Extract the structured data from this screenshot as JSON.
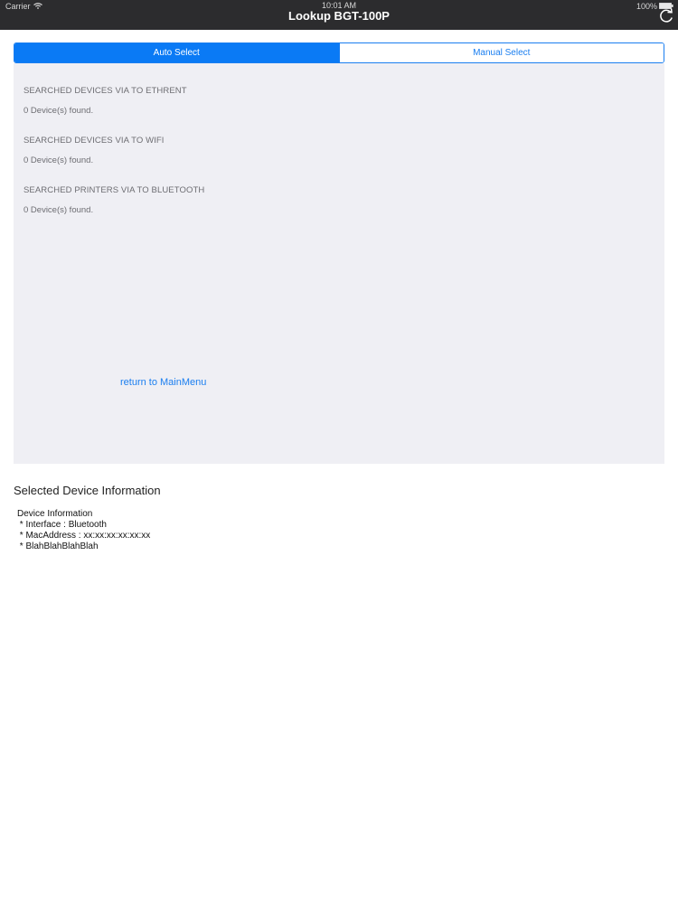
{
  "status_bar": {
    "carrier": "Carrier",
    "time": "10:01 AM",
    "battery": "100%"
  },
  "nav": {
    "title": "Lookup BGT-100P"
  },
  "segments": {
    "auto": "Auto Select",
    "manual": "Manual Select",
    "selected": "Auto Select"
  },
  "sections": [
    {
      "title": "SEARCHED DEVICES VIA TO ETHRENT",
      "count": "0 Device(s) found."
    },
    {
      "title": "SEARCHED DEVICES VIA TO WIFI",
      "count": "0 Device(s) found."
    },
    {
      "title": "SEARCHED PRINTERS VIA TO BLUETOOTH",
      "count": "0 Device(s) found."
    }
  ],
  "return_link": "return to MainMenu",
  "selected_info": {
    "heading": "Selected Device Information",
    "lines": [
      "Device Information",
      " * Interface : Bluetooth",
      " * MacAddress : xx:xx:xx:xx:xx:xx",
      " * BlahBlahBlahBlah"
    ]
  },
  "icons": {
    "wifi": "wifi-icon",
    "battery": "battery-icon",
    "refresh": "refresh-icon"
  }
}
